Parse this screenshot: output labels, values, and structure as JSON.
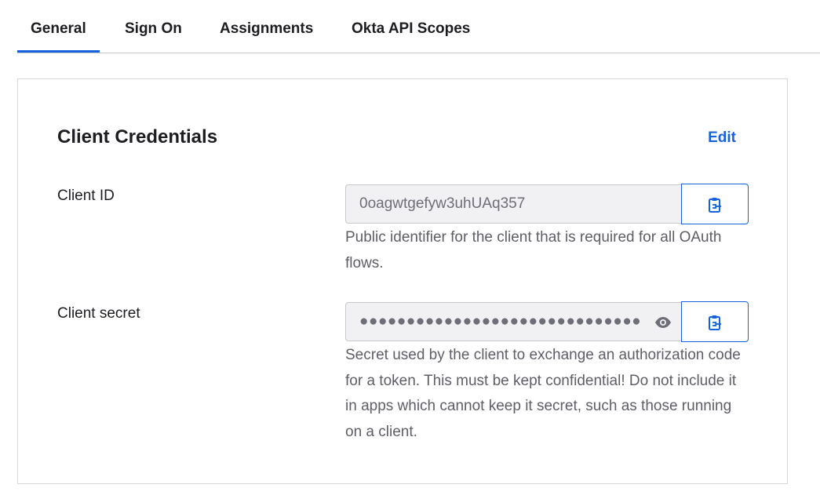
{
  "tabs": [
    {
      "label": "General",
      "active": true
    },
    {
      "label": "Sign On",
      "active": false
    },
    {
      "label": "Assignments",
      "active": false
    },
    {
      "label": "Okta API Scopes",
      "active": false
    }
  ],
  "section": {
    "title": "Client Credentials",
    "edit_label": "Edit"
  },
  "client_id": {
    "label": "Client ID",
    "value": "0oagwtgefyw3uhUAq357",
    "help": "Public identifier for the client that is required for all OAuth flows.",
    "copy_icon": "clipboard-copy-icon"
  },
  "client_secret": {
    "label": "Client secret",
    "masked_value": "●●●●●●●●●●●●●●●●●●●●●●●●●●●●●●●●●●●●●●●●",
    "help": "Secret used by the client to exchange an authorization code for a token. This must be kept confidential! Do not include it in apps which cannot keep it secret, such as those running on a client.",
    "reveal_icon": "eye-icon",
    "copy_icon": "clipboard-copy-icon"
  },
  "colors": {
    "accent": "#1662dd",
    "text": "#1d1d21",
    "muted": "#5e5e66",
    "input_bg": "#f1f1f3"
  }
}
